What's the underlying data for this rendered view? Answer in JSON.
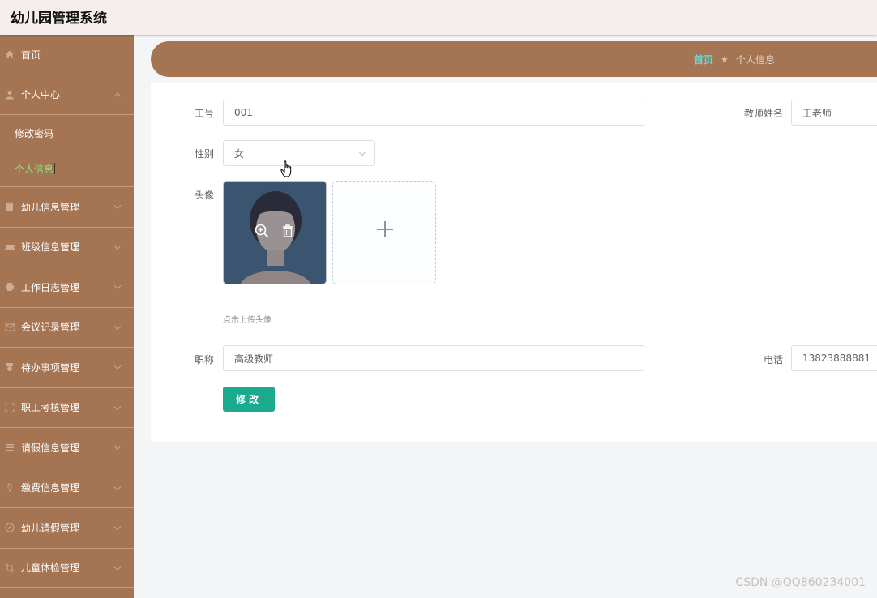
{
  "app": {
    "title": "幼儿园管理系统"
  },
  "sidebar": {
    "items": [
      {
        "label": "首页",
        "icon": "home-icon"
      },
      {
        "label": "个人中心",
        "icon": "user-icon",
        "expanded": true,
        "children": [
          {
            "label": "修改密码"
          },
          {
            "label": "个人信息",
            "active": true
          }
        ]
      },
      {
        "label": "幼儿信息管理",
        "icon": "clipboard-icon"
      },
      {
        "label": "班级信息管理",
        "icon": "ticket-icon"
      },
      {
        "label": "工作日志管理",
        "icon": "printer-icon"
      },
      {
        "label": "会议记录管理",
        "icon": "message-icon"
      },
      {
        "label": "待办事项管理",
        "icon": "medal-icon"
      },
      {
        "label": "职工考核管理",
        "icon": "fullscreen-icon"
      },
      {
        "label": "请假信息管理",
        "icon": "list-icon"
      },
      {
        "label": "缴费信息管理",
        "icon": "microphone-icon"
      },
      {
        "label": "幼儿请假管理",
        "icon": "compass-icon"
      },
      {
        "label": "儿童体检管理",
        "icon": "crop-icon"
      }
    ]
  },
  "breadcrumb": {
    "home": "首页",
    "separator": "★",
    "current": "个人信息"
  },
  "form": {
    "employee_id": {
      "label": "工号",
      "value": "001"
    },
    "teacher_name": {
      "label": "教师姓名",
      "value": "王老师"
    },
    "gender": {
      "label": "性别",
      "value": "女"
    },
    "avatar": {
      "label": "头像",
      "hint": "点击上传头像"
    },
    "title": {
      "label": "职称",
      "value": "高级教师"
    },
    "phone": {
      "label": "电话",
      "value": "13823888881"
    },
    "submit_label": "修改"
  },
  "colors": {
    "sidebar": "#a47453",
    "accent_green": "#1aaa8e",
    "active_item": "#8fe27a"
  },
  "watermark": "CSDN @QQ860234001"
}
